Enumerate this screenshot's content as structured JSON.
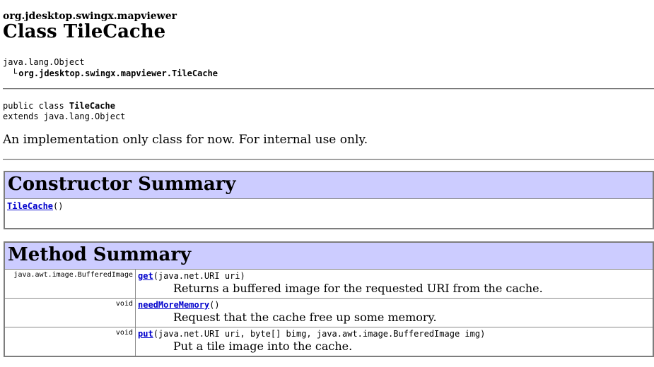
{
  "header": {
    "package": "org.jdesktop.swingx.mapviewer",
    "title": "Class TileCache"
  },
  "hierarchy": {
    "root": "java.lang.Object",
    "branch_glyph": "└",
    "child": "org.jdesktop.swingx.mapviewer.TileCache"
  },
  "declaration": {
    "prefix": "public class ",
    "name": "TileCache",
    "extends": "extends java.lang.Object"
  },
  "description": "An implementation only class for now. For internal use only.",
  "constructor_summary": {
    "title": "Constructor Summary",
    "rows": [
      {
        "name": "TileCache",
        "params": "()"
      }
    ]
  },
  "method_summary": {
    "title": "Method Summary",
    "rows": [
      {
        "return_type": "java.awt.image.BufferedImage",
        "name": "get",
        "params": "(java.net.URI uri)",
        "desc": "Returns a buffered image for the requested URI from the cache."
      },
      {
        "return_type": "void",
        "name": "needMoreMemory",
        "params": "()",
        "desc": "Request that the cache free up some memory."
      },
      {
        "return_type": "void",
        "name": "put",
        "params": "(java.net.URI uri, byte[] bimg, java.awt.image.BufferedImage img)",
        "desc": "Put a tile image into the cache."
      }
    ]
  }
}
